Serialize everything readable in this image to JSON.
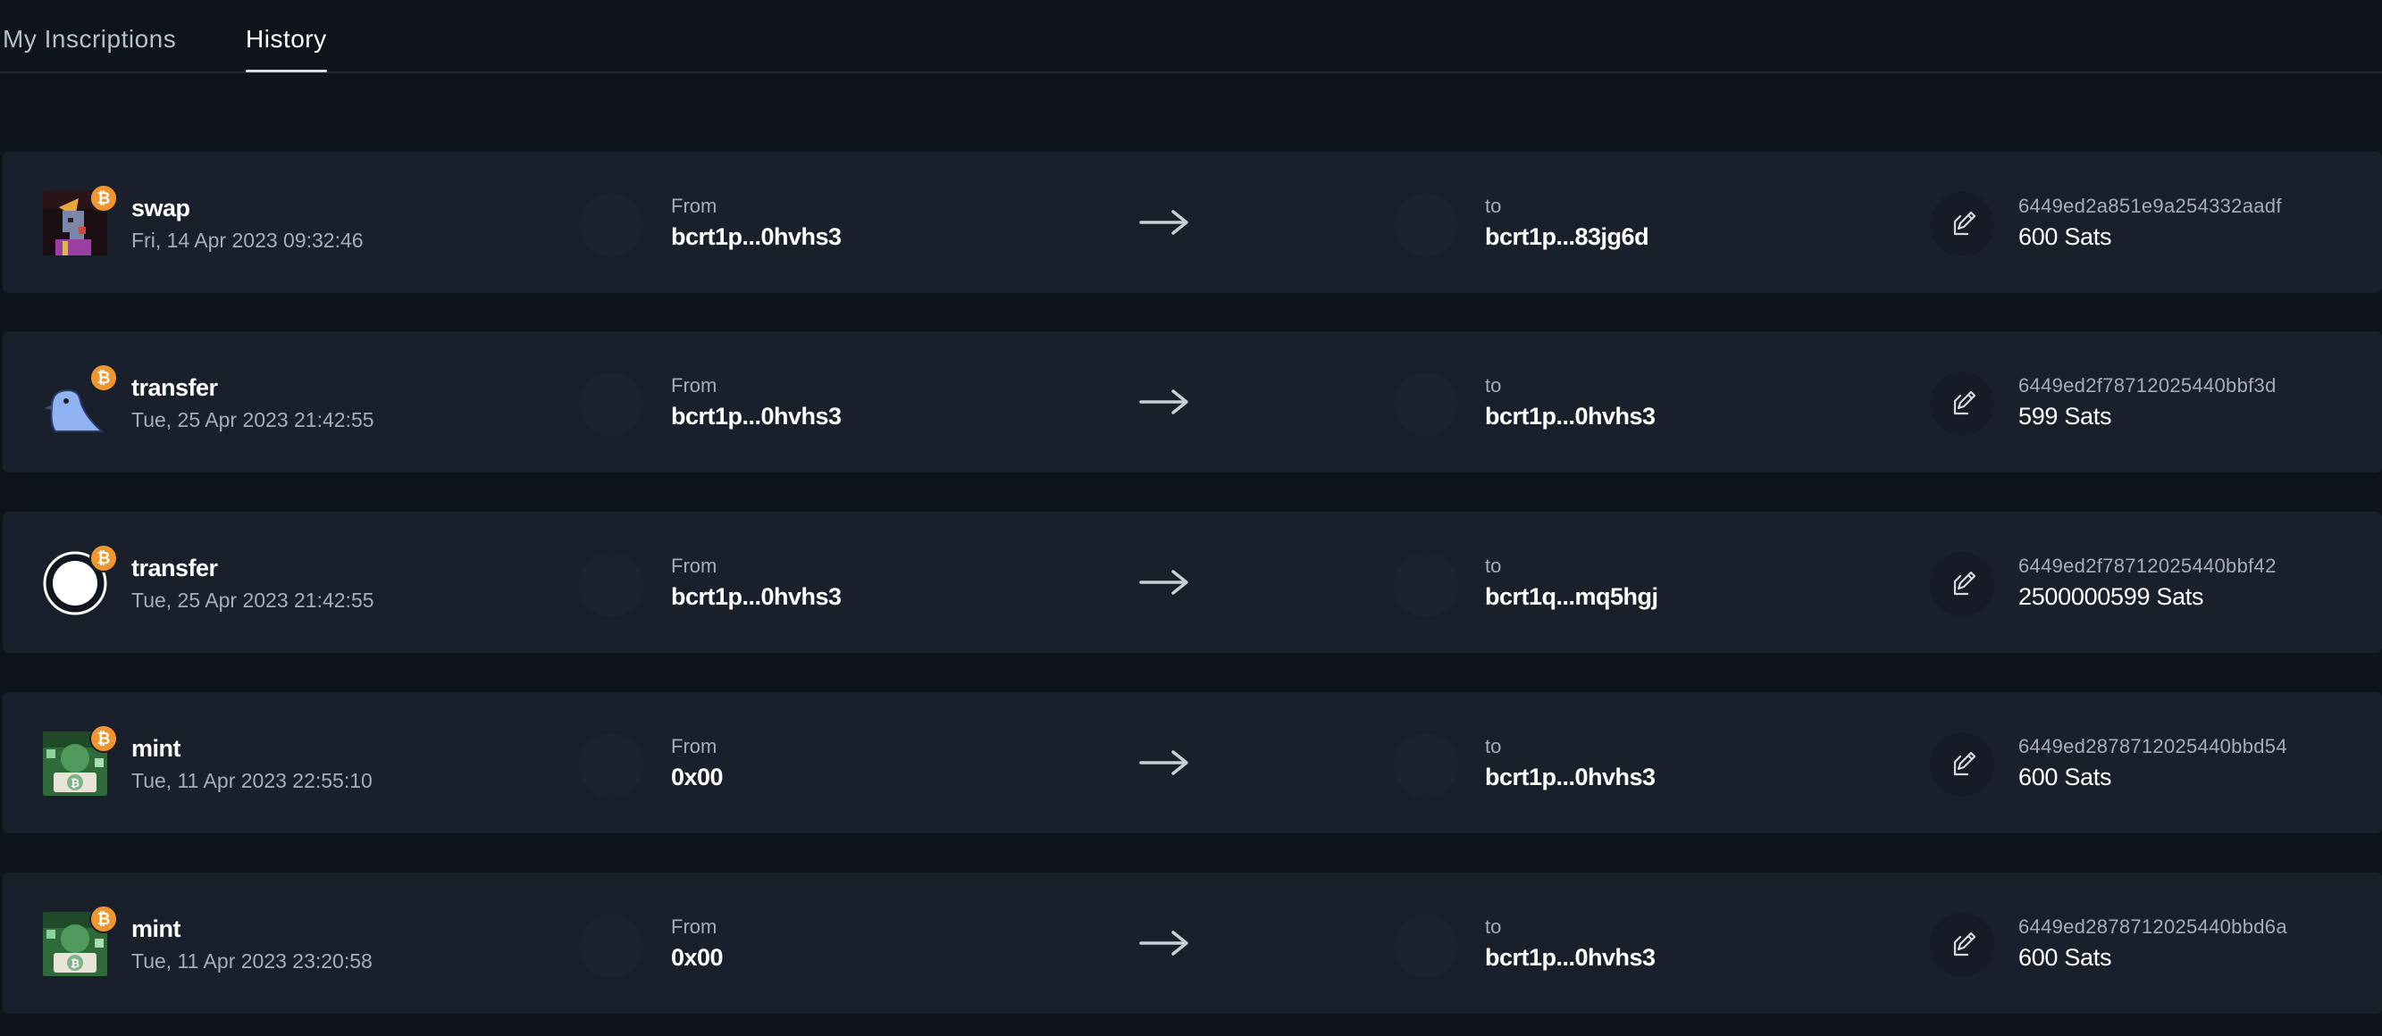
{
  "tabs": [
    {
      "label": "My Inscriptions",
      "active": false
    },
    {
      "label": "History",
      "active": true
    }
  ],
  "history": [
    {
      "type": "swap",
      "date": "Fri, 14 Apr 2023 09:32:46",
      "avatar": "punk-character-avatar",
      "from_label": "From",
      "from": "bcrt1p...0hvhs3",
      "to_label": "to",
      "to": "bcrt1p...83jg6d",
      "txid": "6449ed2a851e9a254332aadf",
      "amount": "600 Sats"
    },
    {
      "type": "transfer",
      "date": "Tue, 25 Apr 2023 21:42:55",
      "avatar": "bird-avatar",
      "from_label": "From",
      "from": "bcrt1p...0hvhs3",
      "to_label": "to",
      "to": "bcrt1p...0hvhs3",
      "txid": "6449ed2f78712025440bbf3d",
      "amount": "599 Sats"
    },
    {
      "type": "transfer",
      "date": "Tue, 25 Apr 2023 21:42:55",
      "avatar": "white-circle-avatar",
      "from_label": "From",
      "from": "bcrt1p...0hvhs3",
      "to_label": "to",
      "to": "bcrt1q...mq5hgj",
      "txid": "6449ed2f78712025440bbf42",
      "amount": "2500000599 Sats"
    },
    {
      "type": "mint",
      "date": "Tue, 11 Apr 2023 22:55:10",
      "avatar": "green-bitcoin-art-avatar",
      "from_label": "From",
      "from": "0x00",
      "to_label": "to",
      "to": "bcrt1p...0hvhs3",
      "txid": "6449ed2878712025440bbd54",
      "amount": "600 Sats"
    },
    {
      "type": "mint",
      "date": "Tue, 11 Apr 2023 23:20:58",
      "avatar": "green-bitcoin-art-avatar",
      "from_label": "From",
      "from": "0x00",
      "to_label": "to",
      "to": "bcrt1p...0hvhs3",
      "txid": "6449ed2878712025440bbd6a",
      "amount": "600 Sats"
    }
  ],
  "icons": {
    "badge": "bitcoin-badge-icon",
    "arrow": "arrow-right-icon",
    "action": "inscribe-pen-icon"
  },
  "colors": {
    "background": "#0f131c",
    "row": "#1a1f2c",
    "bitcoin": "#f0962f",
    "muted_text": "#a7adb8"
  }
}
